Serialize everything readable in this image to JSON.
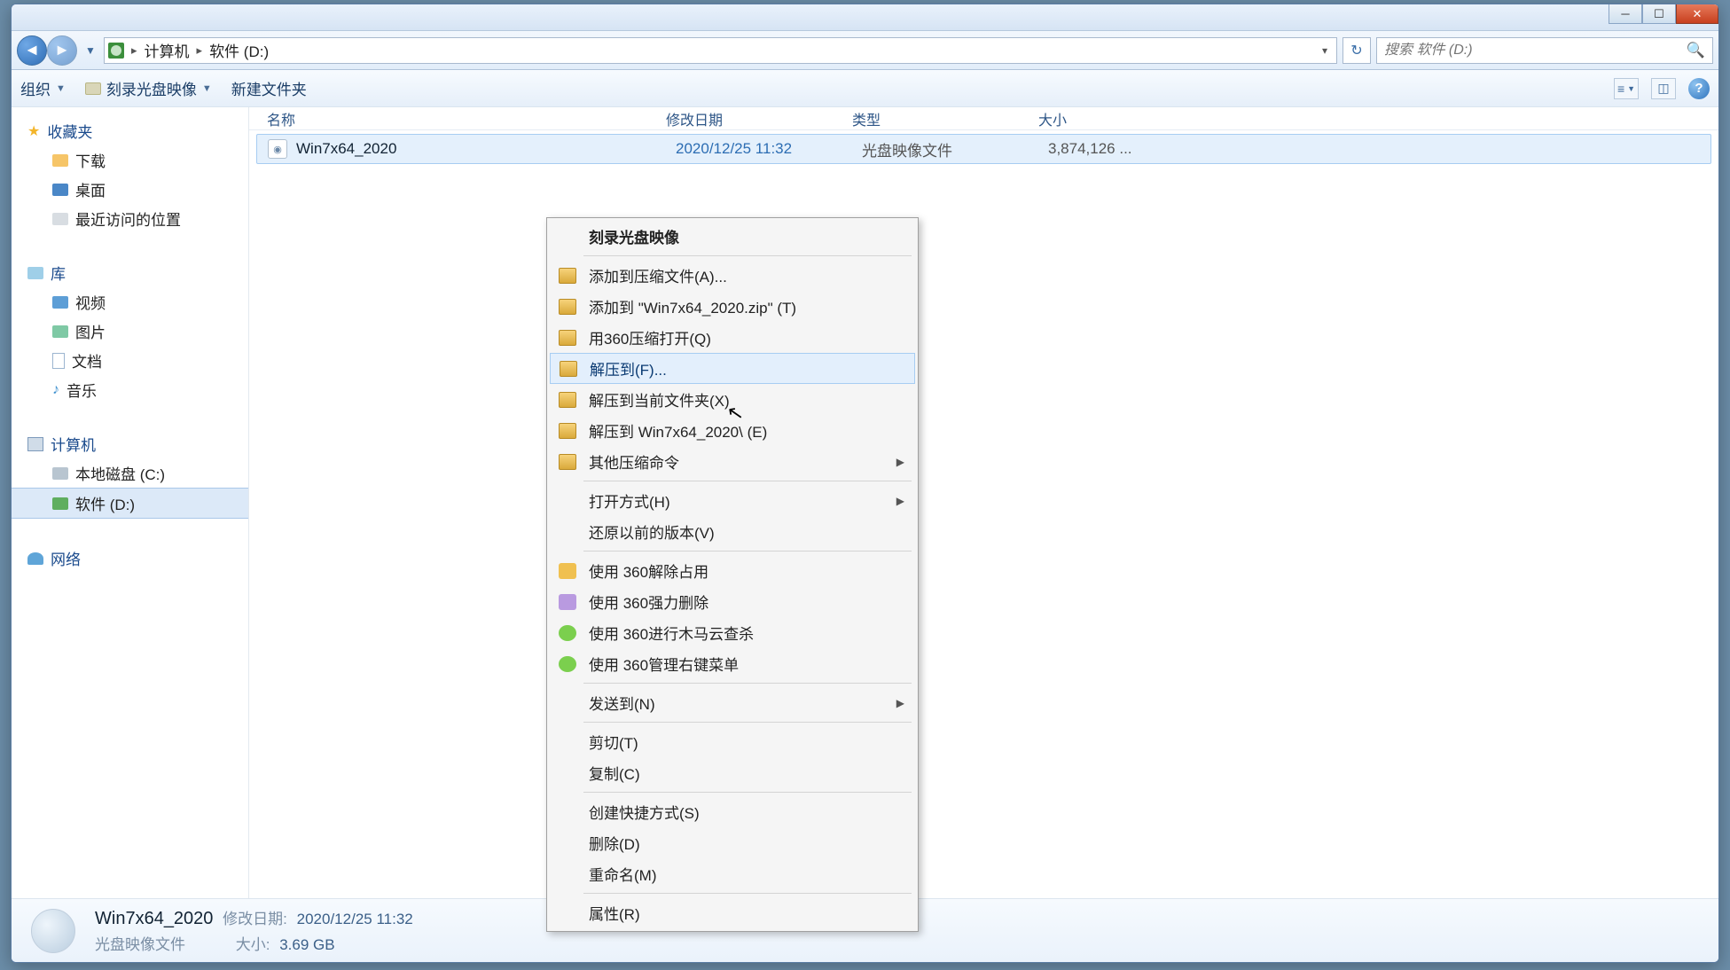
{
  "titlebar": {},
  "nav": {
    "breadcrumb": {
      "root": "计算机",
      "current": "软件 (D:)"
    },
    "search_placeholder": "搜索 软件 (D:)"
  },
  "toolbar": {
    "organize": "组织",
    "burn": "刻录光盘映像",
    "newfolder": "新建文件夹"
  },
  "sidebar": {
    "favorites": {
      "header": "收藏夹",
      "items": [
        "下载",
        "桌面",
        "最近访问的位置"
      ]
    },
    "libraries": {
      "header": "库",
      "items": [
        "视频",
        "图片",
        "文档",
        "音乐"
      ]
    },
    "computer": {
      "header": "计算机",
      "items": [
        "本地磁盘 (C:)",
        "软件 (D:)"
      ]
    },
    "network": {
      "header": "网络"
    }
  },
  "columns": {
    "name": "名称",
    "date": "修改日期",
    "type": "类型",
    "size": "大小"
  },
  "file": {
    "name": "Win7x64_2020",
    "date": "2020/12/25 11:32",
    "type": "光盘映像文件",
    "size": "3,874,126 ..."
  },
  "context_menu": {
    "burn": "刻录光盘映像",
    "add_archive": "添加到压缩文件(A)...",
    "add_zip": "添加到 \"Win7x64_2020.zip\" (T)",
    "open_360": "用360压缩打开(Q)",
    "extract_to": "解压到(F)...",
    "extract_here": "解压到当前文件夹(X)",
    "extract_named": "解压到 Win7x64_2020\\ (E)",
    "other_comp": "其他压缩命令",
    "open_with": "打开方式(H)",
    "restore_prev": "还原以前的版本(V)",
    "use_360_unlock": "使用 360解除占用",
    "use_360_delete": "使用 360强力删除",
    "use_360_scan": "使用 360进行木马云查杀",
    "use_360_menu": "使用 360管理右键菜单",
    "send_to": "发送到(N)",
    "cut": "剪切(T)",
    "copy": "复制(C)",
    "shortcut": "创建快捷方式(S)",
    "delete": "删除(D)",
    "rename": "重命名(M)",
    "properties": "属性(R)"
  },
  "details": {
    "name": "Win7x64_2020",
    "type": "光盘映像文件",
    "date_label": "修改日期:",
    "date_value": "2020/12/25 11:32",
    "size_label": "大小:",
    "size_value": "3.69 GB"
  }
}
